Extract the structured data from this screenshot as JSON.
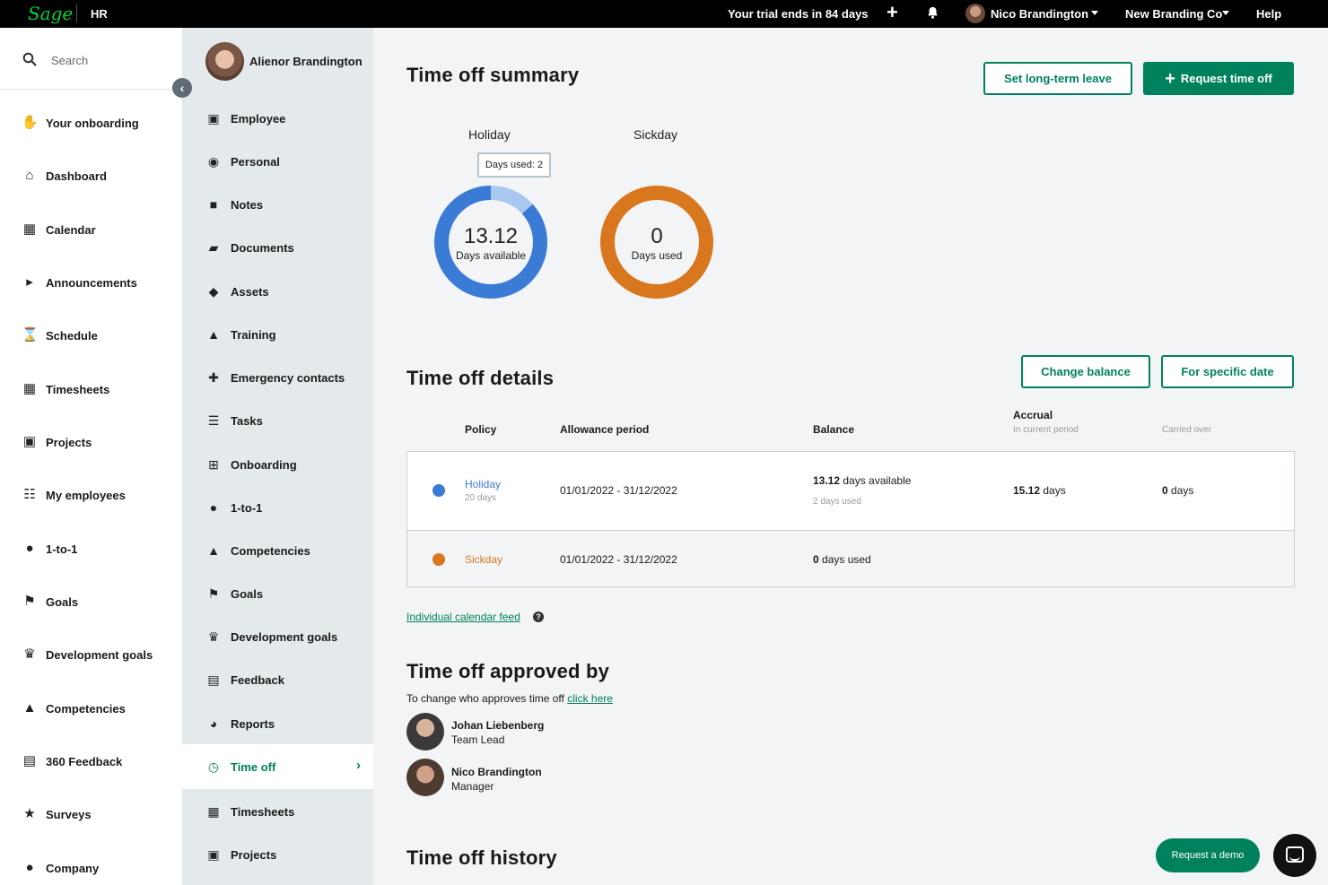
{
  "topbar": {
    "logo": "Sage",
    "product": "HR",
    "trial": "Your trial ends in 84 days",
    "user": "Nico Brandington",
    "company": "New Branding Co",
    "help": "Help",
    "icons": [
      "plus-icon",
      "bell-icon",
      "chevron-down-icon"
    ]
  },
  "sidebar": {
    "search_label": "Search",
    "items": [
      {
        "label": "Your onboarding",
        "icon": "handshake-icon"
      },
      {
        "label": "Dashboard",
        "icon": "home-icon"
      },
      {
        "label": "Calendar",
        "icon": "calendar-icon"
      },
      {
        "label": "Announcements",
        "icon": "megaphone-icon"
      },
      {
        "label": "Schedule",
        "icon": "hourglass-icon"
      },
      {
        "label": "Timesheets",
        "icon": "table-icon"
      },
      {
        "label": "Projects",
        "icon": "briefcase-icon"
      },
      {
        "label": "My employees",
        "icon": "org-chart-icon"
      },
      {
        "label": "1-to-1",
        "icon": "chat-icon"
      },
      {
        "label": "Goals",
        "icon": "flag-icon"
      },
      {
        "label": "Development goals",
        "icon": "trophy-icon"
      },
      {
        "label": "Competencies",
        "icon": "graduation-cap-icon"
      },
      {
        "label": "360 Feedback",
        "icon": "document-icon"
      },
      {
        "label": "Surveys",
        "icon": "star-icon"
      },
      {
        "label": "Company",
        "icon": "users-icon"
      }
    ]
  },
  "subnav": {
    "profile_name": "Alienor Brandington",
    "items": [
      {
        "label": "Employee",
        "icon": "briefcase-icon"
      },
      {
        "label": "Personal",
        "icon": "eye-icon"
      },
      {
        "label": "Notes",
        "icon": "note-icon"
      },
      {
        "label": "Documents",
        "icon": "folder-icon"
      },
      {
        "label": "Assets",
        "icon": "tags-icon"
      },
      {
        "label": "Training",
        "icon": "graduation-cap-icon"
      },
      {
        "label": "Emergency contacts",
        "icon": "medkit-icon"
      },
      {
        "label": "Tasks",
        "icon": "tasks-icon"
      },
      {
        "label": "Onboarding",
        "icon": "plus-square-icon"
      },
      {
        "label": "1-to-1",
        "icon": "chat-icon"
      },
      {
        "label": "Competencies",
        "icon": "graduation-cap-icon"
      },
      {
        "label": "Goals",
        "icon": "flag-icon"
      },
      {
        "label": "Development goals",
        "icon": "trophy-icon"
      },
      {
        "label": "Feedback",
        "icon": "document-icon"
      },
      {
        "label": "Reports",
        "icon": "pie-chart-icon"
      },
      {
        "label": "Time off",
        "icon": "clock-icon",
        "active": true
      },
      {
        "label": "Timesheets",
        "icon": "table-icon"
      },
      {
        "label": "Projects",
        "icon": "briefcase-icon"
      }
    ]
  },
  "summary": {
    "title": "Time off summary",
    "set_leave": "Set long-term leave",
    "request": "Request time off",
    "holiday": {
      "title": "Holiday",
      "tooltip": "Days used: 2",
      "value": "13.12",
      "sub": "Days available",
      "used_fraction": 0.1323,
      "color": "#3a7bd5",
      "used_color": "#a9c8f0"
    },
    "sickday": {
      "title": "Sickday",
      "value": "0",
      "sub": "Days used",
      "color": "#d9771e"
    }
  },
  "details": {
    "title": "Time off details",
    "change_balance": "Change balance",
    "specific_date": "For specific date",
    "headers": {
      "policy": "Policy",
      "period": "Allowance period",
      "balance": "Balance",
      "accrual": "Accrual",
      "accrual_sub": "In current period",
      "carried_sub": "Carried over"
    },
    "rows": [
      {
        "policy": "Holiday",
        "policy_sub": "20 days",
        "color": "#3a7bd5",
        "period": "01/01/2022 - 31/12/2022",
        "balance_num": "13.12",
        "balance_text": " days available",
        "balance_sub": "2 days used",
        "accrual_num": "15.12",
        "accrual_text": " days",
        "carried_num": "0",
        "carried_text": " days"
      },
      {
        "policy": "Sickday",
        "color": "#d9771e",
        "period": "01/01/2022 - 31/12/2022",
        "balance_num": "0",
        "balance_text": " days used"
      }
    ],
    "calendar_feed": "Individual calendar feed"
  },
  "approved": {
    "title": "Time off approved by",
    "note": "To change who approves time off ",
    "note_link": "click here",
    "approvers": [
      {
        "name": "Johan Liebenberg",
        "role": "Team Lead"
      },
      {
        "name": "Nico Brandington",
        "role": "Manager"
      }
    ]
  },
  "history": {
    "title": "Time off history"
  },
  "floating": {
    "demo": "Request a demo"
  }
}
